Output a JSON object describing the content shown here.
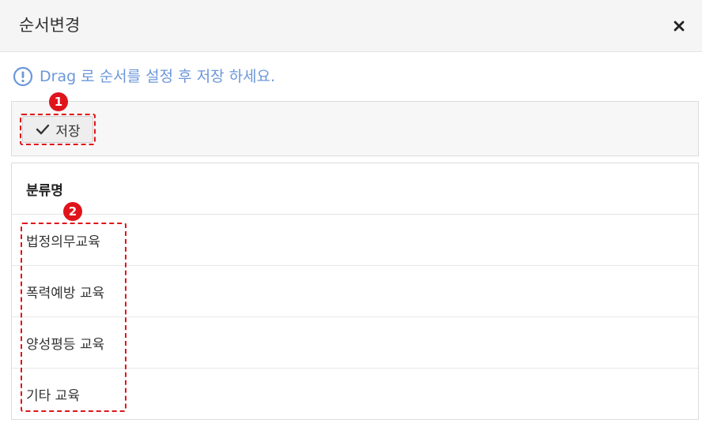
{
  "dialog": {
    "title": "순서변경",
    "close_icon": "close-icon"
  },
  "notice": {
    "icon": "exclamation-circle-icon",
    "text": "Drag 로 순서를 설정 후 저장 하세요."
  },
  "toolbar": {
    "save_icon": "check-icon",
    "save_label": "저장"
  },
  "grid": {
    "column_header": "분류명",
    "rows": [
      "법정의무교육",
      "폭력예방 교육",
      "양성평등 교육",
      "기타 교육"
    ]
  },
  "annotations": {
    "marker_1": "1",
    "marker_2": "2"
  },
  "colors": {
    "accent_blue": "#6b97db",
    "highlight_red": "#e0141b",
    "header_bg": "#f5f5f5"
  }
}
